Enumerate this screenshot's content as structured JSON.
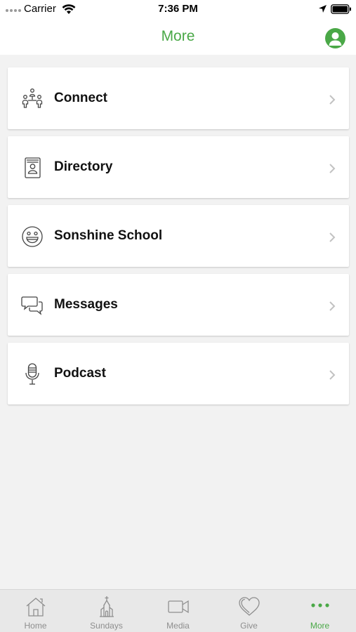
{
  "status_bar": {
    "carrier": "Carrier",
    "time": "7:36 PM"
  },
  "nav": {
    "title": "More"
  },
  "menu": {
    "items": [
      {
        "label": "Connect",
        "icon": "people-network-icon"
      },
      {
        "label": "Directory",
        "icon": "directory-book-icon"
      },
      {
        "label": "Sonshine School",
        "icon": "smiley-face-icon"
      },
      {
        "label": "Messages",
        "icon": "chat-bubbles-icon"
      },
      {
        "label": "Podcast",
        "icon": "microphone-icon"
      }
    ]
  },
  "tabbar": {
    "tabs": [
      {
        "label": "Home",
        "icon": "home-icon",
        "active": false
      },
      {
        "label": "Sundays",
        "icon": "church-icon",
        "active": false
      },
      {
        "label": "Media",
        "icon": "video-camera-icon",
        "active": false
      },
      {
        "label": "Give",
        "icon": "heart-icon",
        "active": false
      },
      {
        "label": "More",
        "icon": "more-dots-icon",
        "active": true
      }
    ]
  },
  "colors": {
    "accent": "#4aa847",
    "background": "#f2f2f2",
    "tabbar_bg": "#e8e8e8",
    "inactive_tab": "#8e8e8e"
  }
}
